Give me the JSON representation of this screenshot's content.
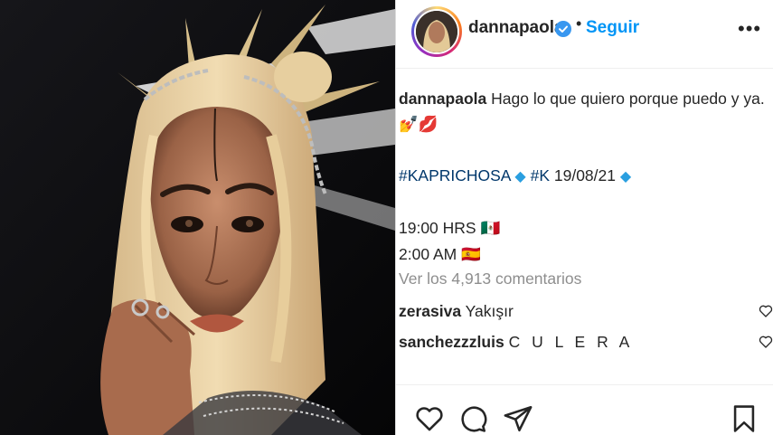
{
  "post": {
    "username": "dannapaola",
    "follow_label": "Seguir",
    "separator": "•",
    "more_label": "•••",
    "caption": {
      "username": "dannapaola",
      "line1": "Hago lo que quiero porque puedo y ya.",
      "line2_emoji": "💅💋",
      "hashtag1": "#KAPRICHOSA",
      "hashtag2": "#K",
      "date": "19/08/21",
      "time_mx": "19:00 HRS",
      "flag_mx": "🇲🇽",
      "time_es": "2:00 AM",
      "flag_es": "🇪🇸"
    },
    "view_comments": "Ver los 4,913 comentarios",
    "comments": [
      {
        "user": "zerasiva",
        "text": "Yakışır"
      },
      {
        "user": "sanchezzzluis",
        "text": "C U L E R A"
      }
    ]
  },
  "icons": [
    "heart-icon",
    "comment-icon",
    "share-icon",
    "bookmark-icon",
    "verified-icon",
    "more-icon"
  ],
  "colors": {
    "link": "#0095f6",
    "hashtag": "#00376b",
    "muted": "#8e8e8e",
    "text": "#262626"
  }
}
